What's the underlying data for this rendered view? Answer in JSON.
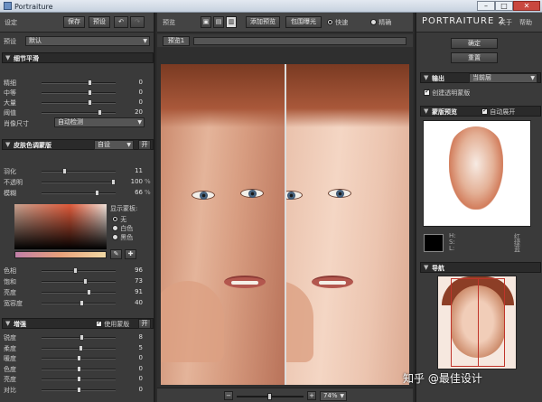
{
  "window": {
    "title": "Portraiture",
    "min_icon": "minimize-icon",
    "max_icon": "maximize-icon",
    "close_icon": "close-icon"
  },
  "left": {
    "settings_label": "设定",
    "save_label": "保存",
    "preset_label": "预设",
    "undo_icon": "undo-icon",
    "redo_icon": "redo-icon",
    "preset_select_label": "预设",
    "preset_value": "默认",
    "detail_section": {
      "title": "细节平滑",
      "sliders": [
        {
          "name": "精细",
          "value": "0",
          "pos": 0.66
        },
        {
          "name": "中等",
          "value": "0",
          "pos": 0.66
        },
        {
          "name": "大量",
          "value": "0",
          "pos": 0.66
        },
        {
          "name": "阈值",
          "value": "20",
          "pos": 0.8
        }
      ],
      "portrait_size_label": "肖像尺寸",
      "portrait_size_value": "自动检测"
    },
    "skin_section": {
      "title": "皮肤色调蒙版",
      "mode_value": "自设",
      "open_label": "开",
      "sliders": [
        {
          "name": "羽化",
          "value": "11",
          "unit": "",
          "pos": 0.3
        },
        {
          "name": "不透明",
          "value": "100",
          "unit": "%",
          "pos": 1.0
        },
        {
          "name": "模糊",
          "value": "66",
          "unit": "%",
          "pos": 0.76
        }
      ],
      "show_mask_label": "显示蒙板:",
      "radio_options": [
        "无",
        "白色",
        "黑色"
      ],
      "radio_selected": 0,
      "eyedropper_icon": "eyedropper-icon",
      "eyedropper_plus_icon": "eyedropper-plus-icon",
      "color_sliders": [
        {
          "name": "色相",
          "value": "96",
          "unit": "",
          "pos": 0.45
        },
        {
          "name": "饱和",
          "value": "73",
          "unit": "",
          "pos": 0.6
        },
        {
          "name": "亮度",
          "value": "91",
          "unit": "",
          "pos": 0.65
        },
        {
          "name": "宽容度",
          "value": "40",
          "unit": "",
          "pos": 0.55
        }
      ]
    },
    "enhance_section": {
      "title": "增强",
      "use_mask_label": "使用蒙版",
      "open_label": "开",
      "sliders": [
        {
          "name": "锐度",
          "value": "8",
          "pos": 0.55
        },
        {
          "name": "柔度",
          "value": "5",
          "pos": 0.53
        },
        {
          "name": "暖度",
          "value": "0",
          "pos": 0.5
        },
        {
          "name": "色度",
          "value": "0",
          "pos": 0.5
        },
        {
          "name": "亮度",
          "value": "0",
          "pos": 0.5
        },
        {
          "name": "对比",
          "value": "0",
          "pos": 0.5
        }
      ]
    }
  },
  "mid": {
    "preview_label": "预览",
    "add_preview_label": "添加预览",
    "clip_label": "包围曝光",
    "fast_label": "快速",
    "precise_label": "精确",
    "fast_selected": true,
    "tab_label": "预览1",
    "zoom_value": "74%"
  },
  "right": {
    "brand": "PORTRAITURE 2",
    "about_label": "关于",
    "help_label": "帮助",
    "ok_label": "确定",
    "reset_label": "重置",
    "output_section": {
      "title": "输出",
      "layer_value": "当前层",
      "create_layer_label": "创建透明蒙版"
    },
    "mask_preview_section": {
      "title": "蒙版预览",
      "auto_expand_label": "自动展开"
    },
    "readout": {
      "h": "H:",
      "s": "S:",
      "l": "L:",
      "red": "红",
      "green": "绿",
      "blue": "蓝"
    },
    "navigator_title": "导航"
  },
  "watermark": "知乎 @最佳设计"
}
